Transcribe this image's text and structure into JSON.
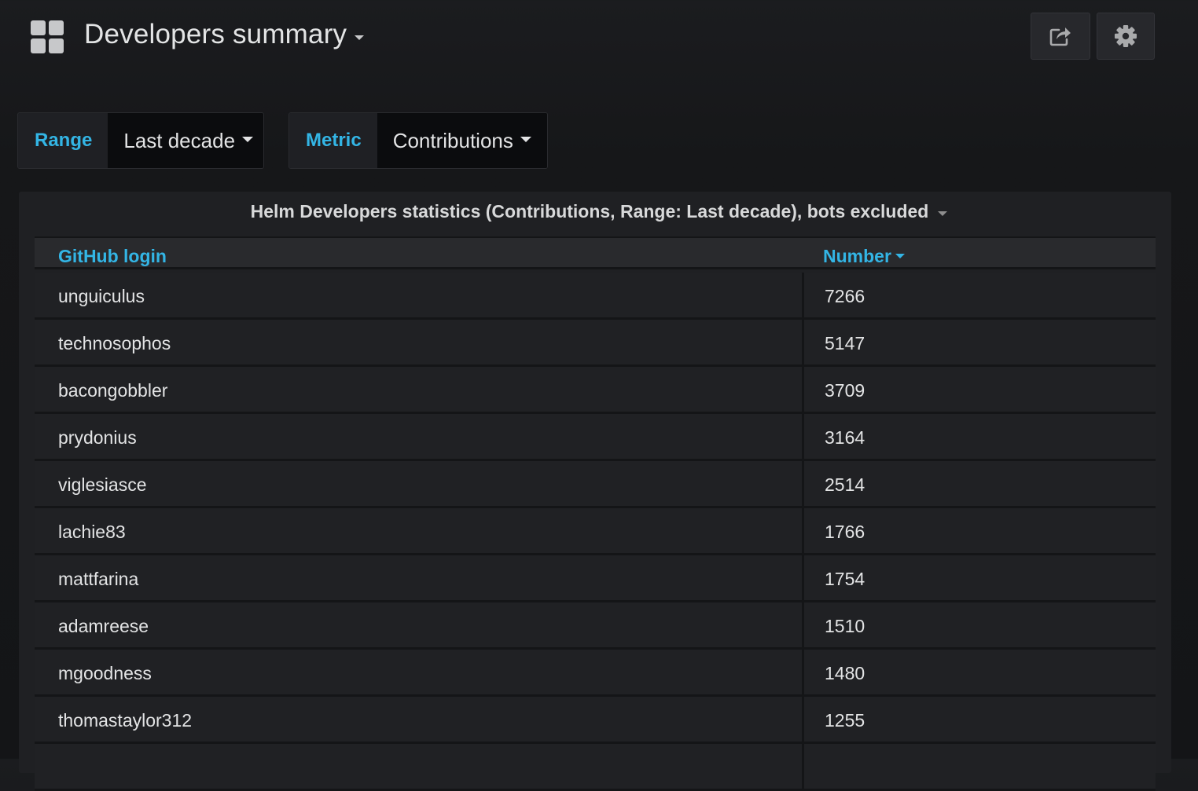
{
  "header": {
    "title": "Developers summary",
    "dashboard_icon": "grid-icon",
    "share_icon": "share-icon",
    "settings_icon": "gear-icon"
  },
  "variables": {
    "range": {
      "label": "Range",
      "value": "Last decade"
    },
    "metric": {
      "label": "Metric",
      "value": "Contributions"
    }
  },
  "panel": {
    "title": "Helm Developers statistics (Contributions, Range: Last decade), bots excluded",
    "columns": [
      "GitHub login",
      "Number"
    ],
    "rows": [
      {
        "login": "unguiculus",
        "number": "7266"
      },
      {
        "login": "technosophos",
        "number": "5147"
      },
      {
        "login": "bacongobbler",
        "number": "3709"
      },
      {
        "login": "prydonius",
        "number": "3164"
      },
      {
        "login": "viglesiasce",
        "number": "2514"
      },
      {
        "login": "lachie83",
        "number": "1766"
      },
      {
        "login": "mattfarina",
        "number": "1754"
      },
      {
        "login": "adamreese",
        "number": "1510"
      },
      {
        "login": "mgoodness",
        "number": "1480"
      },
      {
        "login": "thomastaylor312",
        "number": "1255"
      },
      {
        "login": "",
        "number": ""
      }
    ]
  },
  "colors": {
    "accent": "#33b5e5",
    "background": "#161719",
    "panel": "#1f2023"
  }
}
